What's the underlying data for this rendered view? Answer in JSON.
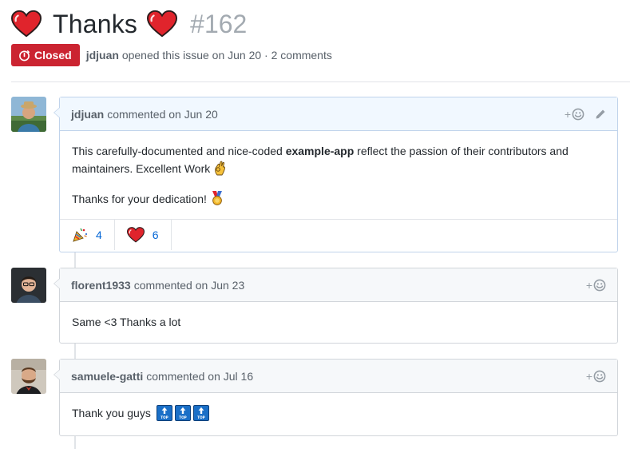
{
  "issue": {
    "title": "Thanks",
    "number": "#162",
    "state": "Closed",
    "author": "jdjuan",
    "meta": "opened this issue on Jun 20 · 2 comments"
  },
  "comments": [
    {
      "author": "jdjuan",
      "action": "commented on Jun 20",
      "paragraphs": [
        {
          "before": "This carefully-documented and nice-coded ",
          "bold": "example-app",
          "after": " reflect the passion of their contributors and maintainers. Excellent Work",
          "emoji": "ok-hand-icon"
        },
        {
          "text": "Thanks for your dedication!",
          "emoji": "medal-icon"
        }
      ],
      "reactions": [
        {
          "icon": "party-popper-icon",
          "count": "4"
        },
        {
          "icon": "heart-icon",
          "count": "6"
        }
      ]
    },
    {
      "author": "florent1933",
      "action": "commented on Jun 23",
      "body": "Same <3 Thanks a lot"
    },
    {
      "author": "samuele-gatti",
      "action": "commented on Jul 16",
      "body": "Thank you guys",
      "emoji_count": 3,
      "emoji": "top-arrow-icon",
      "emoji_caption": "TOP"
    }
  ],
  "colors": {
    "closed_badge": "#cb2431",
    "link": "#0366d6",
    "owner_header": "#f1f8ff",
    "header": "#f6f8fa"
  }
}
